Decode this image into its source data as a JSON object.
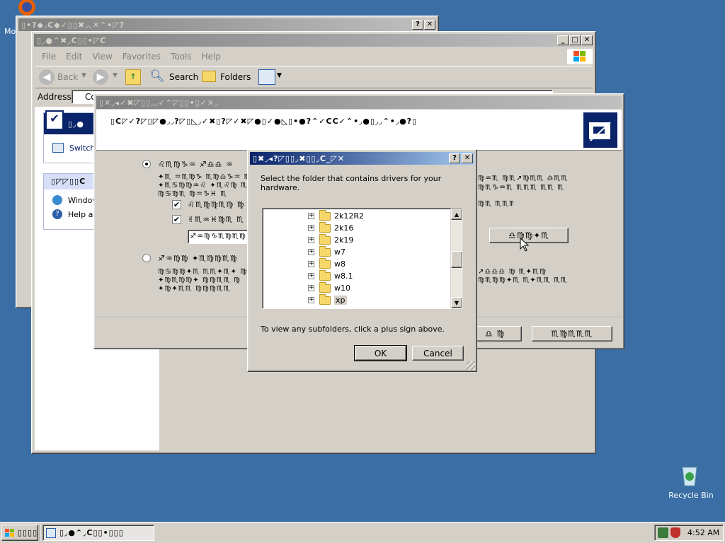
{
  "desktop": {
    "top_left_label": "Mo",
    "recycle_bin_label": "Recycle Bin"
  },
  "back_window": {
    "title": "▯•?◆◞C◆✓▯▯✖◞◟✕⌃•◸?"
  },
  "explorer": {
    "title": "▯◞●⌃✖◞C▯▯•◸C",
    "menu": [
      "File",
      "Edit",
      "View",
      "Favorites",
      "Tools",
      "Help"
    ],
    "toolbar": {
      "back_label": "Back",
      "search_label": "Search",
      "folders_label": "Folders"
    },
    "address_label": "Address",
    "address_value": "Co",
    "left_panel": {
      "task_title": "▯◞●",
      "switch_label": "Switch",
      "other_title": "▯◸◸▯▯C",
      "windows_label": "Window",
      "help_label": "Help ar"
    }
  },
  "wizard": {
    "title": "▯✕◞◂✓✖◸▯▯◞◞✓⌃◸▯▯•▯✓✕◞",
    "header_text": "▯C◸✓?◸▯◸●◞◞?◸▯◺◞✓✖▯?◸✓✖◸●▯✓●◺▯•●?⌃✓CC✓⌃•◞●▯◞◞⌃•◞●?▯",
    "option1_label": "♌♏♍♑♒ ♐♎♎ ♒",
    "option1_desc1": "✦♏ ♒♏♍♑ ♏♍♎♑♒ ♏",
    "option1_desc2": "✦♏♋♍♍♒♌ ✦♏♌♍ ♏",
    "option1_desc3": "♍♋♍♏ ♍♒♑♓ ♏",
    "check1_label": "♌♏♍♍♏♍ ♍",
    "check2_label": "✌♏♒♓♍♏ ♏",
    "path_value": "♐♒♍♑♏♍♏♍",
    "browse_label": "♎♍♍✦♏",
    "option2_label": "♐♒♍♍ ✦♏♍♍♏♍",
    "option2_desc1": "♍♋♍♍✦♏ ♏♏✦♏✦ ♍♍",
    "option2_desc2": "✦♍♏♍♍✦ ♍♍♏♏ ♍",
    "option2_desc3": "✦♍✦♏♏ ♍♍♍♏♏",
    "right_desc1": "♍♒♏ ♍♏↗♍♏♏ ♎♏♏",
    "right_desc2": "♍♏♑♒♏ ♏♏♏ ♏♏ ♏",
    "right_desc3": "♍♏ ♏♏♏",
    "right_desc4": "↗♎♎♎ ♍ ♏✦♏♍",
    "right_desc5": "♍♏♍♍✦♏ ♏✦♏♏ ♏♏",
    "back_button_label": "♎ ♍",
    "next_button_label": "♏♍♏♏♏"
  },
  "dialog": {
    "title": "▯✖◞◂?◸▯▯◞✖▯▯◞C_◸✕",
    "prompt": "Select the folder that contains drivers for your hardware.",
    "tree_items": [
      "2k12R2",
      "2k16",
      "2k19",
      "w7",
      "w8",
      "w8.1",
      "w10",
      "xp"
    ],
    "selected_item": "xp",
    "hint": "To view any subfolders, click a plus sign above.",
    "ok_label": "OK",
    "cancel_label": "Cancel"
  },
  "taskbar": {
    "start_label": "▯▯▯▯",
    "task_label": "▯◞●⌃◞C▯▯•▯▯▯",
    "clock": "4:52 AM"
  },
  "colors": {
    "desktop": "#3a6ea5",
    "active_title": "#0a246a",
    "face": "#d4d0c8"
  }
}
